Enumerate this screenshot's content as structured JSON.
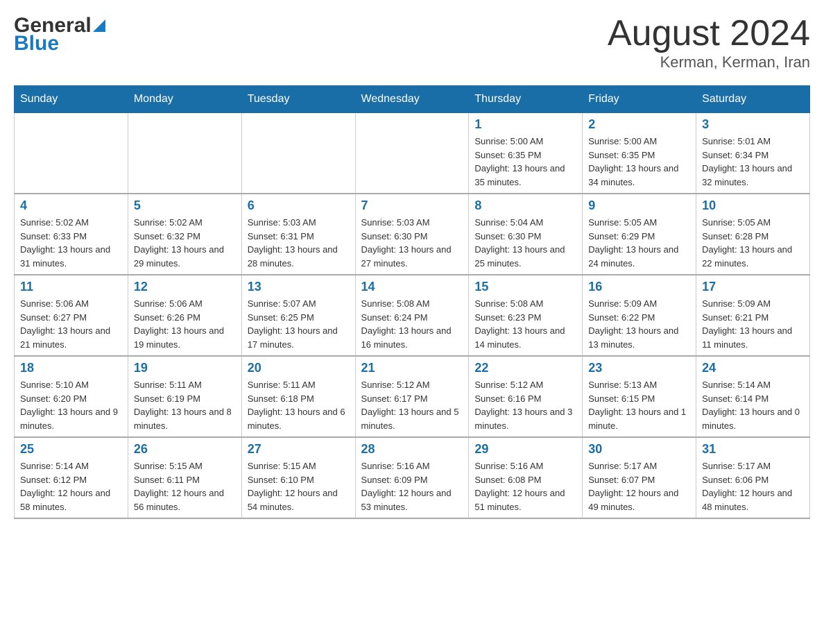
{
  "header": {
    "logo": {
      "general": "General",
      "blue": "Blue"
    },
    "title": "August 2024",
    "location": "Kerman, Kerman, Iran"
  },
  "calendar": {
    "days_of_week": [
      "Sunday",
      "Monday",
      "Tuesday",
      "Wednesday",
      "Thursday",
      "Friday",
      "Saturday"
    ],
    "weeks": [
      [
        {
          "day": "",
          "info": ""
        },
        {
          "day": "",
          "info": ""
        },
        {
          "day": "",
          "info": ""
        },
        {
          "day": "",
          "info": ""
        },
        {
          "day": "1",
          "info": "Sunrise: 5:00 AM\nSunset: 6:35 PM\nDaylight: 13 hours and 35 minutes."
        },
        {
          "day": "2",
          "info": "Sunrise: 5:00 AM\nSunset: 6:35 PM\nDaylight: 13 hours and 34 minutes."
        },
        {
          "day": "3",
          "info": "Sunrise: 5:01 AM\nSunset: 6:34 PM\nDaylight: 13 hours and 32 minutes."
        }
      ],
      [
        {
          "day": "4",
          "info": "Sunrise: 5:02 AM\nSunset: 6:33 PM\nDaylight: 13 hours and 31 minutes."
        },
        {
          "day": "5",
          "info": "Sunrise: 5:02 AM\nSunset: 6:32 PM\nDaylight: 13 hours and 29 minutes."
        },
        {
          "day": "6",
          "info": "Sunrise: 5:03 AM\nSunset: 6:31 PM\nDaylight: 13 hours and 28 minutes."
        },
        {
          "day": "7",
          "info": "Sunrise: 5:03 AM\nSunset: 6:30 PM\nDaylight: 13 hours and 27 minutes."
        },
        {
          "day": "8",
          "info": "Sunrise: 5:04 AM\nSunset: 6:30 PM\nDaylight: 13 hours and 25 minutes."
        },
        {
          "day": "9",
          "info": "Sunrise: 5:05 AM\nSunset: 6:29 PM\nDaylight: 13 hours and 24 minutes."
        },
        {
          "day": "10",
          "info": "Sunrise: 5:05 AM\nSunset: 6:28 PM\nDaylight: 13 hours and 22 minutes."
        }
      ],
      [
        {
          "day": "11",
          "info": "Sunrise: 5:06 AM\nSunset: 6:27 PM\nDaylight: 13 hours and 21 minutes."
        },
        {
          "day": "12",
          "info": "Sunrise: 5:06 AM\nSunset: 6:26 PM\nDaylight: 13 hours and 19 minutes."
        },
        {
          "day": "13",
          "info": "Sunrise: 5:07 AM\nSunset: 6:25 PM\nDaylight: 13 hours and 17 minutes."
        },
        {
          "day": "14",
          "info": "Sunrise: 5:08 AM\nSunset: 6:24 PM\nDaylight: 13 hours and 16 minutes."
        },
        {
          "day": "15",
          "info": "Sunrise: 5:08 AM\nSunset: 6:23 PM\nDaylight: 13 hours and 14 minutes."
        },
        {
          "day": "16",
          "info": "Sunrise: 5:09 AM\nSunset: 6:22 PM\nDaylight: 13 hours and 13 minutes."
        },
        {
          "day": "17",
          "info": "Sunrise: 5:09 AM\nSunset: 6:21 PM\nDaylight: 13 hours and 11 minutes."
        }
      ],
      [
        {
          "day": "18",
          "info": "Sunrise: 5:10 AM\nSunset: 6:20 PM\nDaylight: 13 hours and 9 minutes."
        },
        {
          "day": "19",
          "info": "Sunrise: 5:11 AM\nSunset: 6:19 PM\nDaylight: 13 hours and 8 minutes."
        },
        {
          "day": "20",
          "info": "Sunrise: 5:11 AM\nSunset: 6:18 PM\nDaylight: 13 hours and 6 minutes."
        },
        {
          "day": "21",
          "info": "Sunrise: 5:12 AM\nSunset: 6:17 PM\nDaylight: 13 hours and 5 minutes."
        },
        {
          "day": "22",
          "info": "Sunrise: 5:12 AM\nSunset: 6:16 PM\nDaylight: 13 hours and 3 minutes."
        },
        {
          "day": "23",
          "info": "Sunrise: 5:13 AM\nSunset: 6:15 PM\nDaylight: 13 hours and 1 minute."
        },
        {
          "day": "24",
          "info": "Sunrise: 5:14 AM\nSunset: 6:14 PM\nDaylight: 13 hours and 0 minutes."
        }
      ],
      [
        {
          "day": "25",
          "info": "Sunrise: 5:14 AM\nSunset: 6:12 PM\nDaylight: 12 hours and 58 minutes."
        },
        {
          "day": "26",
          "info": "Sunrise: 5:15 AM\nSunset: 6:11 PM\nDaylight: 12 hours and 56 minutes."
        },
        {
          "day": "27",
          "info": "Sunrise: 5:15 AM\nSunset: 6:10 PM\nDaylight: 12 hours and 54 minutes."
        },
        {
          "day": "28",
          "info": "Sunrise: 5:16 AM\nSunset: 6:09 PM\nDaylight: 12 hours and 53 minutes."
        },
        {
          "day": "29",
          "info": "Sunrise: 5:16 AM\nSunset: 6:08 PM\nDaylight: 12 hours and 51 minutes."
        },
        {
          "day": "30",
          "info": "Sunrise: 5:17 AM\nSunset: 6:07 PM\nDaylight: 12 hours and 49 minutes."
        },
        {
          "day": "31",
          "info": "Sunrise: 5:17 AM\nSunset: 6:06 PM\nDaylight: 12 hours and 48 minutes."
        }
      ]
    ]
  }
}
